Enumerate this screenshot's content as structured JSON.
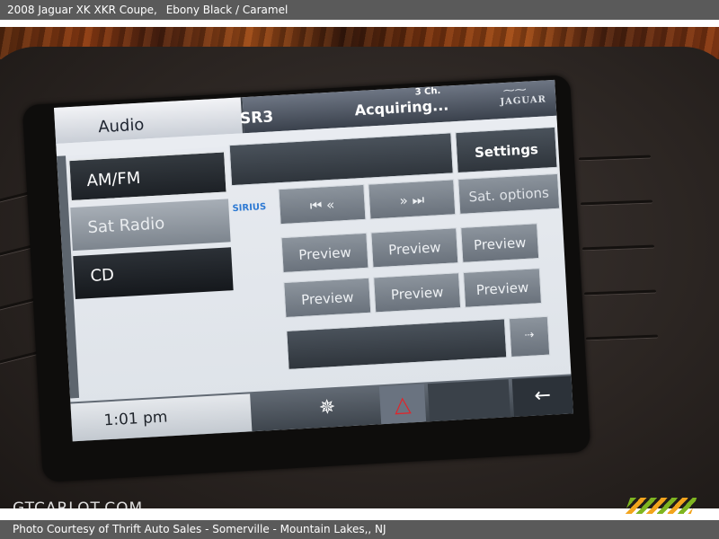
{
  "caption": {
    "title": "2008 Jaguar XK XKR Coupe,",
    "color": "Ebony Black / Caramel",
    "credit": "Photo Courtesy of Thrift Auto Sales - Somerville - Mountain Lakes,, NJ"
  },
  "watermark": "GTCARLOT.COM",
  "screen": {
    "header": {
      "audio_label": "Audio",
      "station": "SR3",
      "status": "Acquiring...",
      "channel": "3 Ch.",
      "brand": "JAGUAR"
    },
    "sources": [
      "AM/FM",
      "Sat Radio",
      "CD"
    ],
    "settings_label": "Settings",
    "sat_options_label": "Sat. options",
    "sirius_label": "SIRIUS",
    "prev_icon": "skip-back",
    "next_icon": "skip-forward",
    "presets": [
      "Preview",
      "Preview",
      "Preview",
      "Preview",
      "Preview",
      "Preview"
    ],
    "page_icon": "chevron-arrow",
    "clock": "1:01  pm",
    "fan_icon": "fan",
    "hazard_icon": "hazard-triangle",
    "back_icon": "back-arrow"
  },
  "colors": {
    "screen_light": "#e9ecf1",
    "button_gray": "#7d858e",
    "button_dark": "#1d2126",
    "hazard_red": "#e0252a",
    "sirius_blue": "#2e7ad3"
  }
}
